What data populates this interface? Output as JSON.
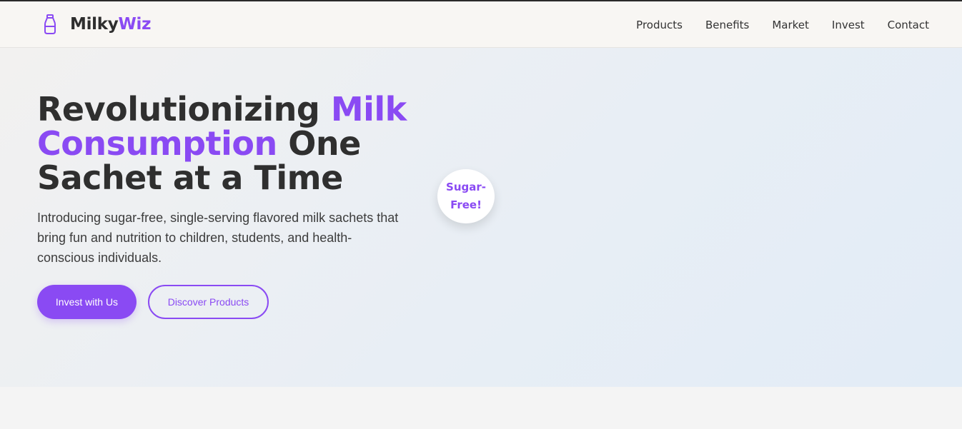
{
  "brand": {
    "name_main": "Milky",
    "name_accent": "Wiz",
    "icon": "milk-bottle-icon"
  },
  "nav": {
    "items": [
      "Products",
      "Benefits",
      "Market",
      "Invest",
      "Contact"
    ]
  },
  "hero": {
    "title_part1": "Revolutionizing ",
    "title_accent": "Milk Consumption",
    "title_part2": " One Sachet at a Time",
    "subtitle": "Introducing sugar-free, single-serving flavored milk sachets that bring fun and nutrition to children, students, and health-conscious individuals.",
    "primary_button": "Invest with Us",
    "secondary_button": "Discover Products",
    "badge": "Sugar-Free!"
  },
  "colors": {
    "accent": "#8a4af3",
    "text": "#2f2f2f",
    "navbar_bg": "#f8f6f3"
  }
}
